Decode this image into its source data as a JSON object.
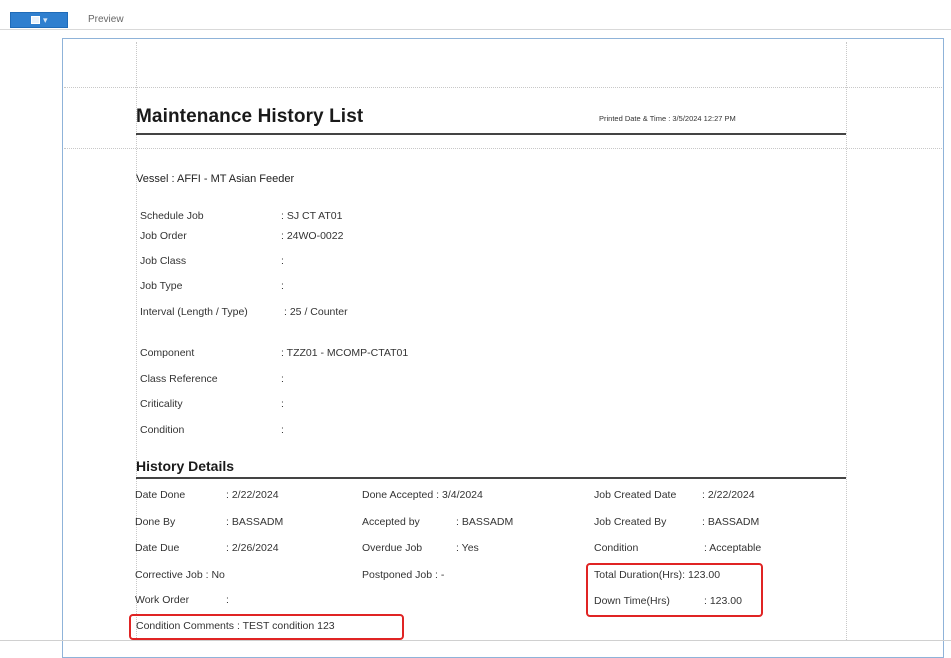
{
  "toolbar": {
    "tab_label": "Preview"
  },
  "report": {
    "title": "Maintenance History List",
    "printed_label": "Printed Date & Time",
    "printed_value": "3/5/2024 12:27 PM",
    "vessel_label": "Vessel",
    "vessel_value": "AFFI - MT Asian Feeder",
    "job_fields": [
      {
        "label": "Schedule Job",
        "value": "SJ CT AT01"
      },
      {
        "label": "Job Order",
        "value": "24WO-0022"
      },
      {
        "label": "Job Class",
        "value": ""
      },
      {
        "label": "Job Type",
        "value": ""
      },
      {
        "label": "Interval (Length / Type)",
        "value": "25 / Counter"
      }
    ],
    "component_fields": [
      {
        "label": "Component",
        "value": "TZZ01 - MCOMP-CTAT01"
      },
      {
        "label": "Class Reference",
        "value": ""
      },
      {
        "label": "Criticality",
        "value": ""
      },
      {
        "label": "Condition",
        "value": ""
      }
    ],
    "history_title": "History Details",
    "history": {
      "col1": [
        {
          "label": "Date Done",
          "value": "2/22/2024"
        },
        {
          "label": "Done By",
          "value": "BASSADM"
        },
        {
          "label": "Date Due",
          "value": "2/26/2024"
        },
        {
          "label": "Corrective Job",
          "value": "No"
        },
        {
          "label": "Work Order",
          "value": ""
        }
      ],
      "col2": [
        {
          "label": "Done Accepted",
          "value": "3/4/2024"
        },
        {
          "label": "Accepted by",
          "value": "BASSADM"
        },
        {
          "label": "Overdue Job",
          "value": "Yes"
        },
        {
          "label": "Postponed Job",
          "value": "-"
        }
      ],
      "col3": [
        {
          "label": "Job Created Date",
          "value": "2/22/2024"
        },
        {
          "label": "Job Created By",
          "value": "BASSADM"
        },
        {
          "label": "Condition",
          "value": "Acceptable"
        },
        {
          "label": "Total Duration(Hrs)",
          "value": "123.00"
        },
        {
          "label": "Down Time(Hrs)",
          "value": "123.00"
        }
      ],
      "condition_comments_label": "Condition Comments",
      "condition_comments_value": "TEST condition 123"
    }
  },
  "colors": {
    "highlight": "#e02424",
    "toolbar_button": "#2f7fcf",
    "frame_border": "#8fb3d9"
  }
}
